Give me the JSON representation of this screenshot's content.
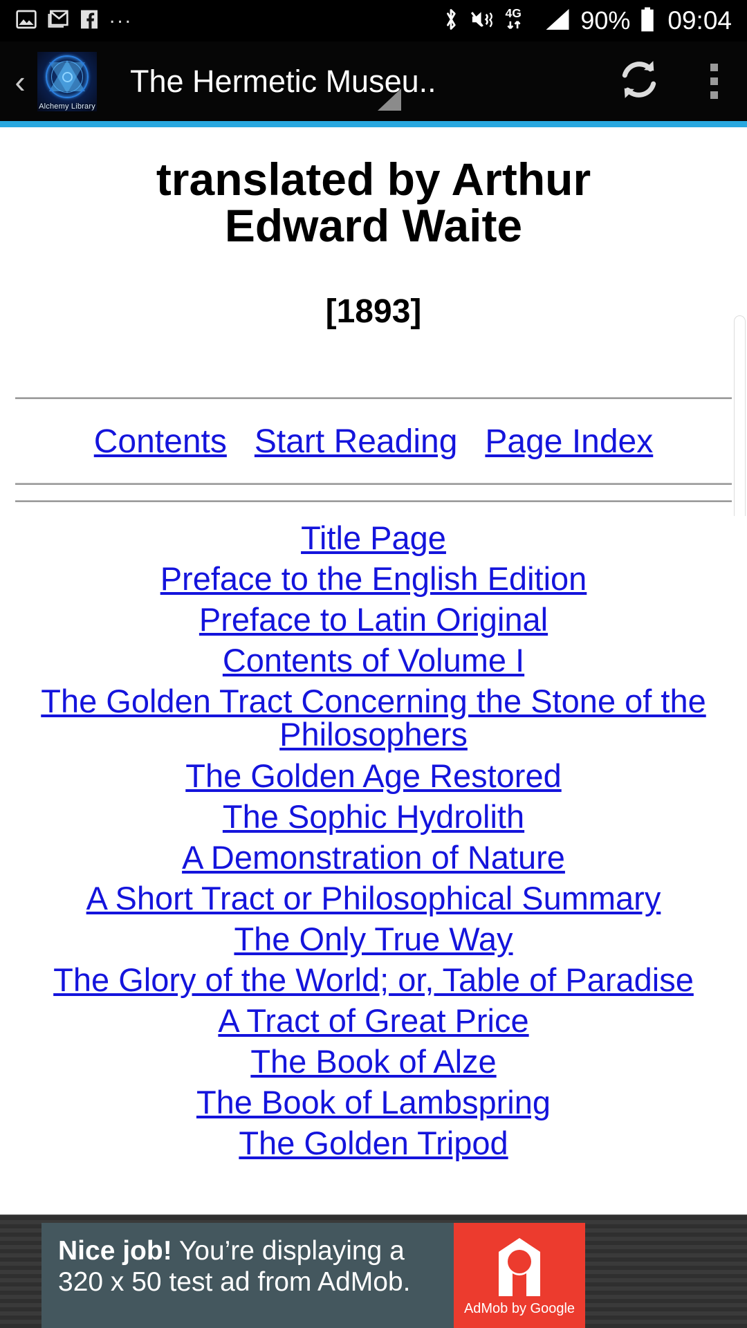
{
  "status_bar": {
    "icons": [
      "image-icon",
      "gmail-icon",
      "facebook-icon",
      "more-notifications-icon"
    ],
    "more_glyph": "...",
    "bluetooth_icon": "bluetooth-icon",
    "mute_icon": "vibrate-mute-icon",
    "network_type": "4G",
    "signal_icon": "signal-bars-icon",
    "battery_percent": "90%",
    "battery_icon": "battery-icon",
    "clock": "09:04"
  },
  "app_bar": {
    "back_label": "‹",
    "app_icon_label": "Alchemy Library",
    "title": "The Hermetic Museu..",
    "refresh_label": "refresh-icon",
    "overflow_label": "overflow-menu-icon",
    "accent_color": "#29a8e0"
  },
  "page": {
    "doc_title_line1": "translated by Arthur",
    "doc_title_line2": "Edward Waite",
    "date": "[1893]",
    "nav_links": [
      {
        "label": "Contents"
      },
      {
        "label": "Start Reading"
      },
      {
        "label": "Page Index"
      }
    ],
    "toc": [
      {
        "label": "Title Page"
      },
      {
        "label": "Preface to the English Edition"
      },
      {
        "label": "Preface to Latin Original"
      },
      {
        "label": "Contents of Volume I"
      },
      {
        "label": "The Golden Tract Concerning the Stone of the Philosophers"
      },
      {
        "label": "The Golden Age Restored"
      },
      {
        "label": "The Sophic Hydrolith"
      },
      {
        "label": "A Demonstration of Nature"
      },
      {
        "label": "A Short Tract or Philosophical Summary"
      },
      {
        "label": "The Only True Way"
      },
      {
        "label": "The Glory of the World; or, Table of Paradise"
      },
      {
        "label": "A Tract of Great Price"
      },
      {
        "label": "The Book of Alze"
      },
      {
        "label": "The Book of Lambspring"
      },
      {
        "label": "The Golden Tripod"
      }
    ],
    "link_color": "#1414dc"
  },
  "ad": {
    "headline": "Nice job!",
    "body": " You’re displaying a 320 x 50 test ad from AdMob.",
    "brand": "AdMob by Google",
    "bg_color": "#44575e",
    "logo_color": "#ec3b2e"
  }
}
